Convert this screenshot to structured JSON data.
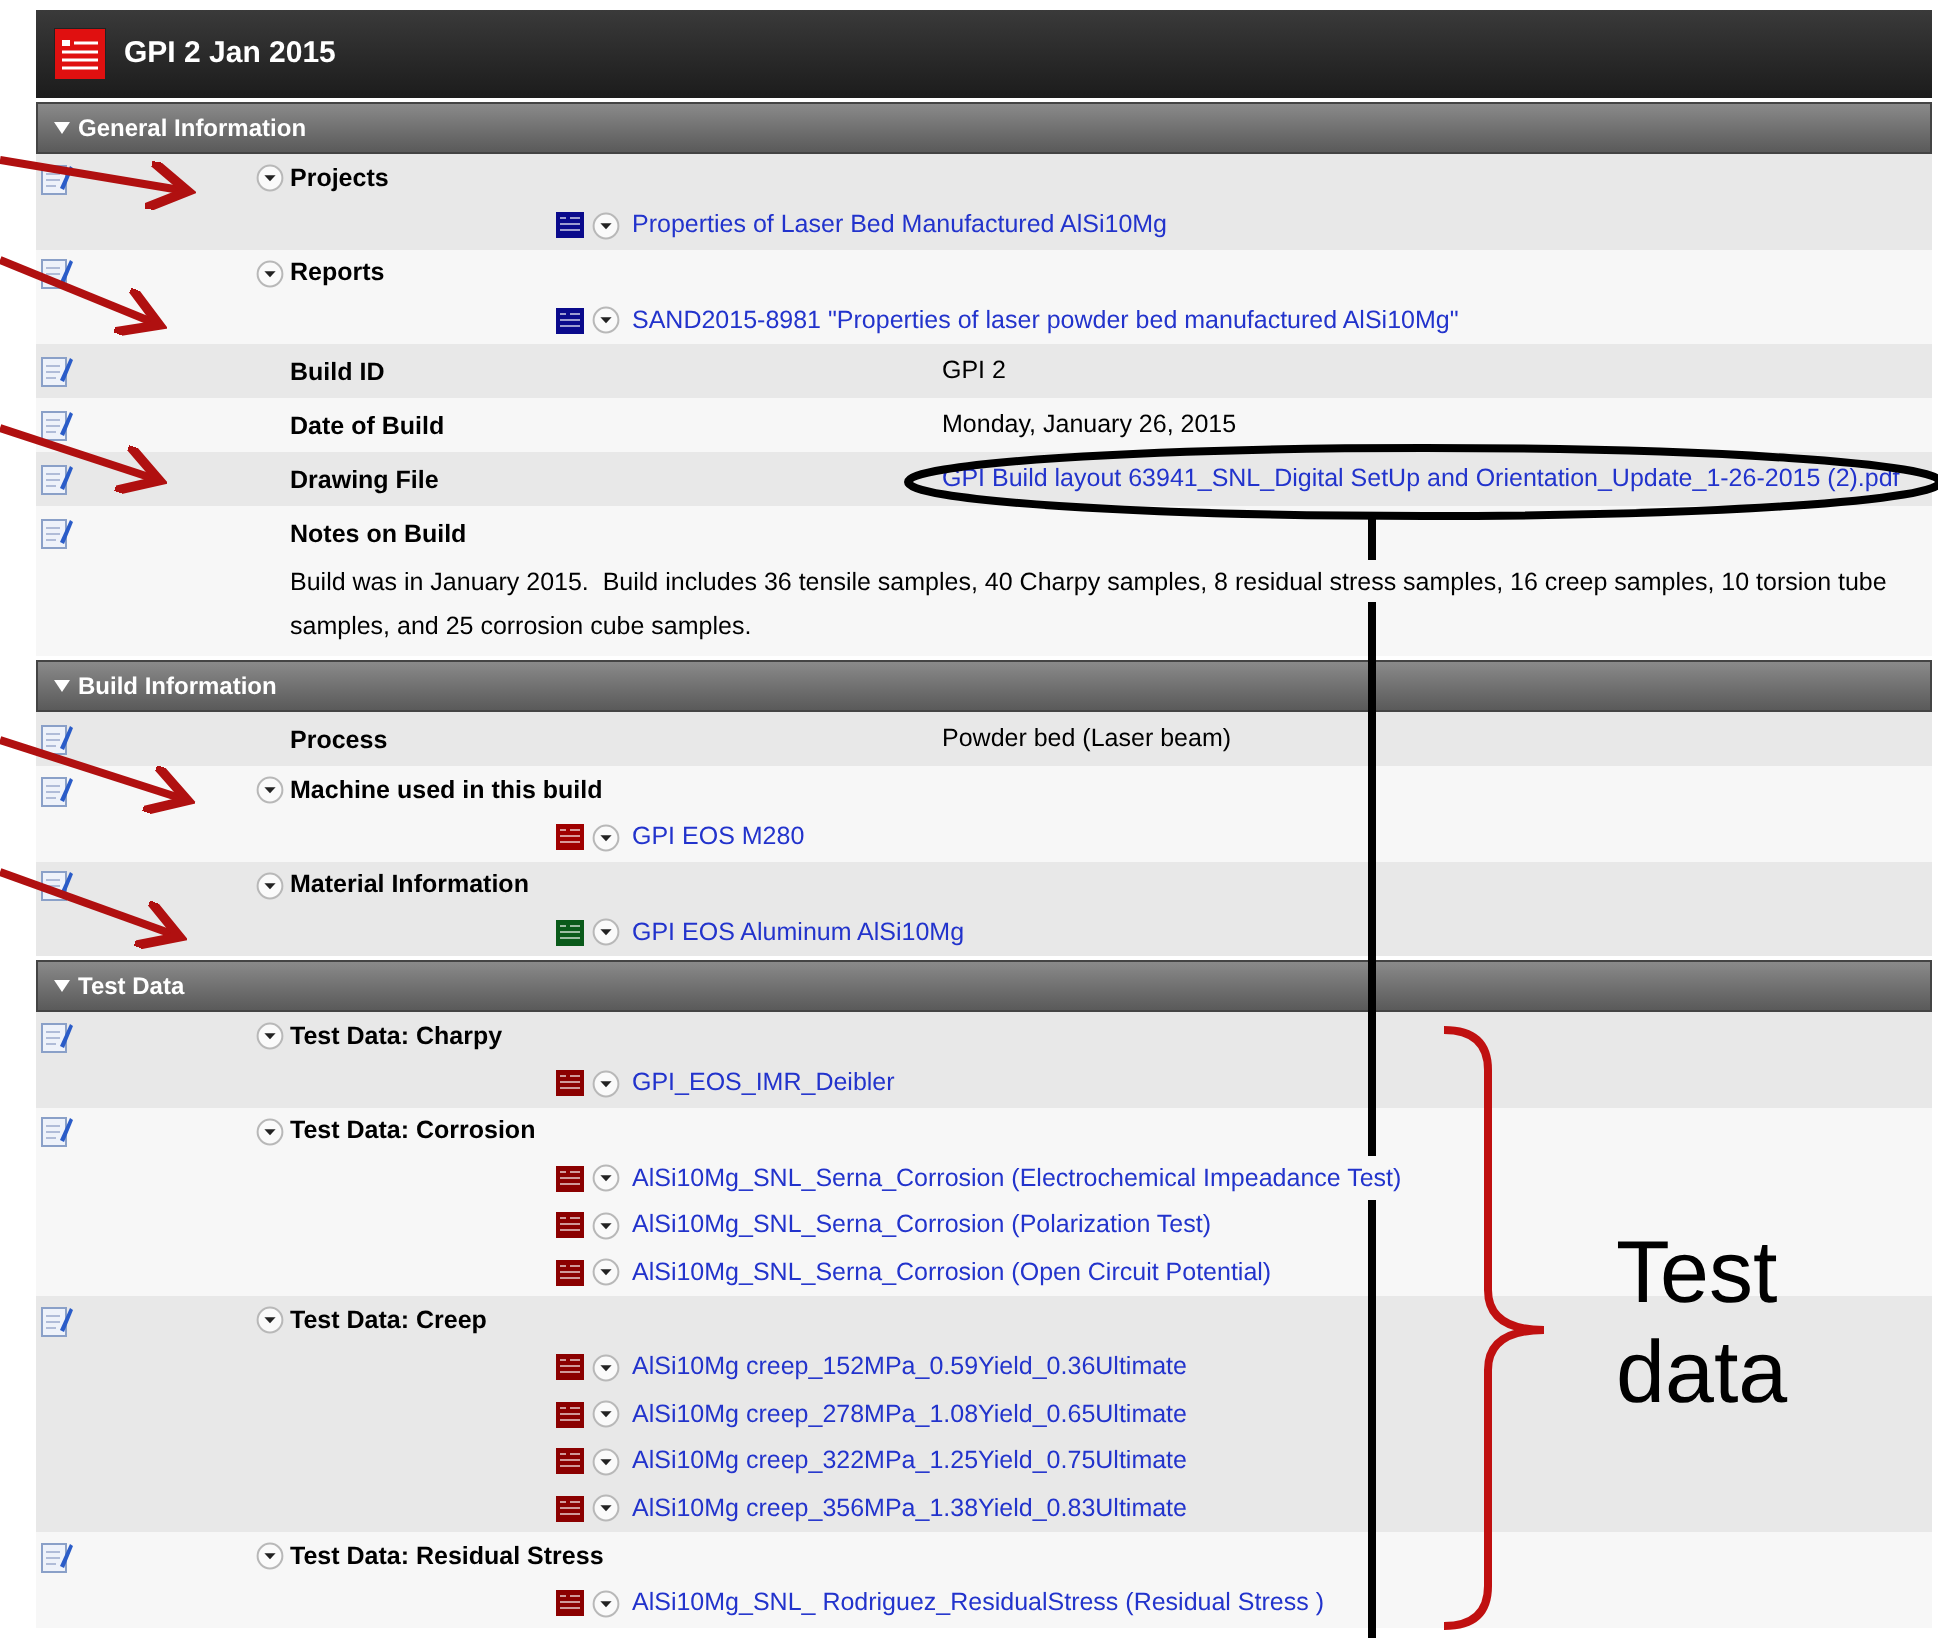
{
  "page": {
    "title": "GPI 2 Jan 2015"
  },
  "sections": [
    {
      "title": "General Information",
      "expanded": true,
      "rows": [
        {
          "kind": "list",
          "label": "Projects",
          "links": [
            {
              "text": "Properties of Laser Bed Manufactured AlSi10Mg",
              "color": "#0a0a8c"
            }
          ]
        },
        {
          "kind": "list",
          "label": "Reports",
          "links": [
            {
              "text": "SAND2015-8981 \"Properties of laser powder bed manufactured AlSi10Mg\"",
              "color": "#0a0a8c"
            }
          ]
        },
        {
          "kind": "field",
          "label": "Build ID",
          "value": "GPI 2"
        },
        {
          "kind": "field",
          "label": "Date of Build",
          "value": "Monday, January 26, 2015"
        },
        {
          "kind": "file",
          "label": "Drawing File",
          "value": "GPI Build layout 63941_SNL_Digital SetUp and Orientation_Update_1-26-2015 (2).pdf"
        },
        {
          "kind": "note",
          "label": "Notes on Build",
          "value": "Build was in January 2015.  Build includes 36 tensile samples, 40 Charpy samples, 8 residual stress samples, 16 creep samples, 10 torsion tube samples, and 25 corrosion cube samples."
        }
      ]
    },
    {
      "title": "Build Information",
      "expanded": true,
      "rows": [
        {
          "kind": "field",
          "label": "Process",
          "value": "Powder bed (Laser beam)"
        },
        {
          "kind": "list",
          "label": "Machine used in this build",
          "links": [
            {
              "text": "GPI EOS M280",
              "color": "#a00000"
            }
          ]
        },
        {
          "kind": "list",
          "label": "Material Information",
          "links": [
            {
              "text": "GPI EOS Aluminum AlSi10Mg",
              "color": "#0a5a1a"
            }
          ]
        }
      ]
    },
    {
      "title": "Test Data",
      "expanded": true,
      "rows": [
        {
          "kind": "list",
          "label": "Test Data: Charpy",
          "links": [
            {
              "text": "GPI_EOS_IMR_Deibler",
              "color": "#8b0000"
            }
          ]
        },
        {
          "kind": "list",
          "label": "Test Data: Corrosion",
          "links": [
            {
              "text": "AlSi10Mg_SNL_Serna_Corrosion (Electrochemical Impeadance Test)",
              "color": "#8b0000"
            },
            {
              "text": "AlSi10Mg_SNL_Serna_Corrosion (Polarization Test)",
              "color": "#8b0000"
            },
            {
              "text": "AlSi10Mg_SNL_Serna_Corrosion (Open Circuit Potential)",
              "color": "#8b0000"
            }
          ]
        },
        {
          "kind": "list",
          "label": "Test Data: Creep",
          "links": [
            {
              "text": "AlSi10Mg creep_152MPa_0.59Yield_0.36Ultimate",
              "color": "#8b0000"
            },
            {
              "text": "AlSi10Mg creep_278MPa_1.08Yield_0.65Ultimate",
              "color": "#8b0000"
            },
            {
              "text": "AlSi10Mg creep_322MPa_1.25Yield_0.75Ultimate",
              "color": "#8b0000"
            },
            {
              "text": "AlSi10Mg creep_356MPa_1.38Yield_0.83Ultimate",
              "color": "#8b0000"
            }
          ]
        },
        {
          "kind": "list",
          "label": "Test Data: Residual Stress",
          "links": [
            {
              "text": "AlSi10Mg_SNL_ Rodriguez_ResidualStress (Residual Stress )",
              "color": "#8b0000"
            }
          ]
        }
      ]
    }
  ],
  "annotation": {
    "label": "Test data"
  }
}
